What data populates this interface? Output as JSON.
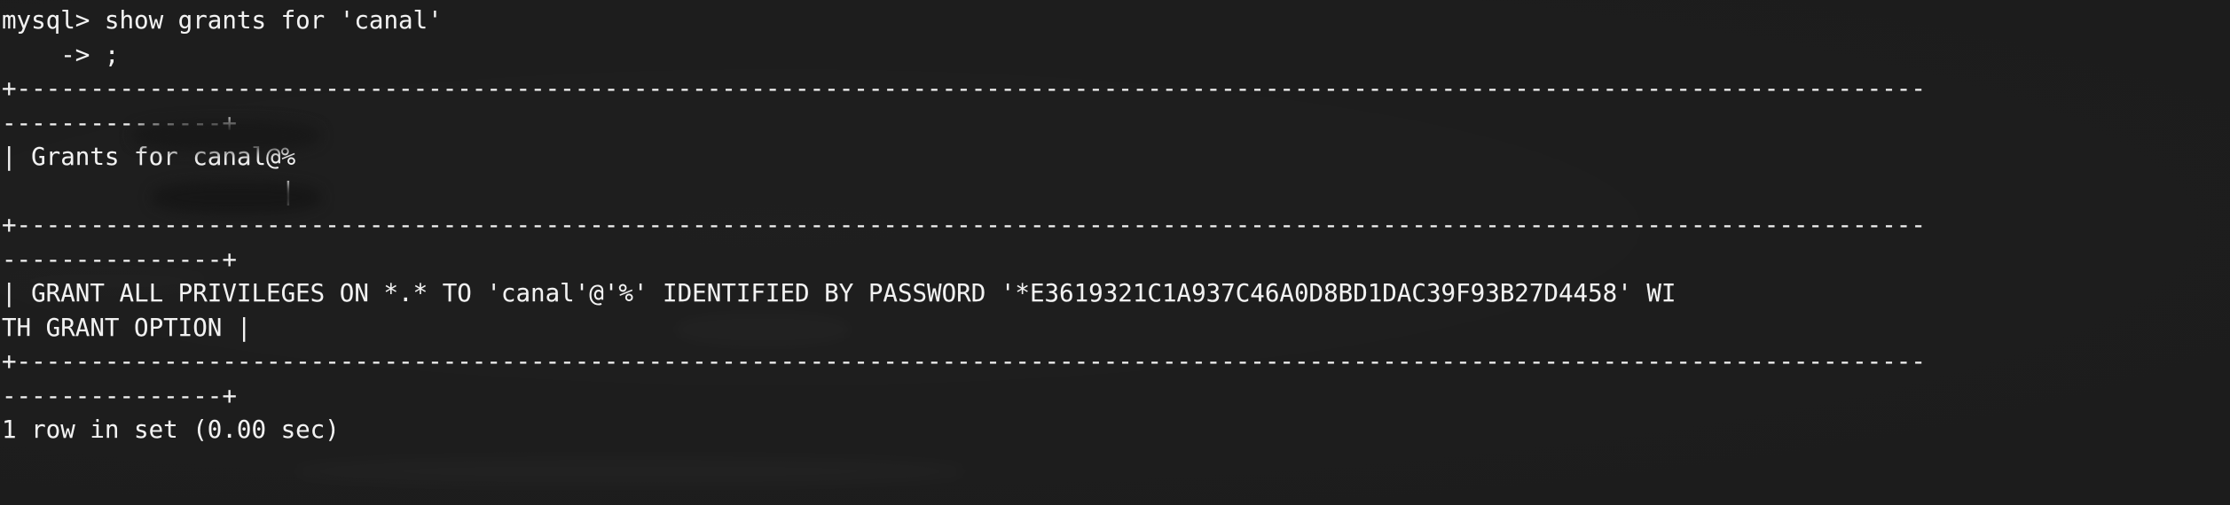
{
  "terminal": {
    "app": "mysql-client",
    "background_color": "#1c1c1c",
    "foreground_color": "#f2f2f2",
    "prompt": "mysql>",
    "continuation_prompt": "->",
    "command": "show grants for 'canal'",
    "terminator": ";",
    "lines": [
      "mysql> show grants for 'canal'",
      "    -> ;",
      "+----------------------------------------------------------------------------------------------------------------------------------",
      "---------------+",
      "| Grants for canal@%",
      "                   |",
      "+----------------------------------------------------------------------------------------------------------------------------------",
      "---------------+",
      "| GRANT ALL PRIVILEGES ON *.* TO 'canal'@'%' IDENTIFIED BY PASSWORD '*E3619321C1A937C46A0D8BD1DAC39F93B27D4458' WI",
      "TH GRANT OPTION |",
      "+----------------------------------------------------------------------------------------------------------------------------------",
      "---------------+",
      "1 row in set (0.00 sec)"
    ],
    "result_table": {
      "column_header": "Grants for canal@%",
      "rows": [
        "GRANT ALL PRIVILEGES ON *.* TO 'canal'@'%' IDENTIFIED BY PASSWORD '*E3619321C1A937C46A0D8BD1DAC39F93B27D4458' WITH GRANT OPTION"
      ],
      "grant_detail": {
        "privileges": "ALL PRIVILEGES",
        "scope": "*.*",
        "user": "'canal'@'%'",
        "password_hash": "*E3619321C1A937C46A0D8BD1DAC39F93B27D4458",
        "with_grant_option": "WITH GRANT OPTION"
      }
    },
    "status": {
      "row_count": "1 row in set",
      "duration": "(0.00 sec)",
      "text": "1 row in set (0.00 sec)"
    }
  }
}
